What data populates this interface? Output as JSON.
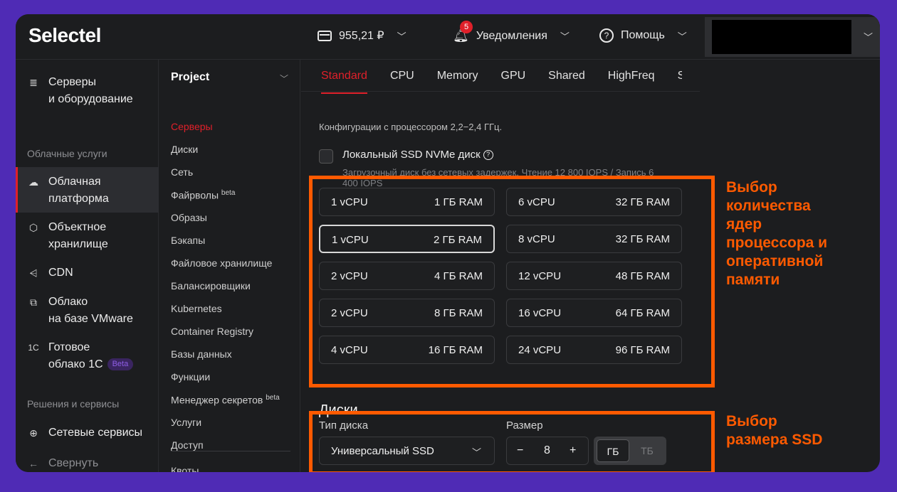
{
  "topbar": {
    "logo": "Selectel",
    "balance": "955,21 ₽",
    "notifications_count": "5",
    "notifications_label": "Уведомления",
    "help_label": "Помощь"
  },
  "sidebar": {
    "items": [
      {
        "icon": "server-icon",
        "line1": "Серверы",
        "line2": "и оборудование"
      },
      {
        "icon": "cloud-icon",
        "line1": "Облачная",
        "line2": "платформа"
      },
      {
        "icon": "cube-icon",
        "line1": "Объектное",
        "line2": "хранилище"
      },
      {
        "icon": "cdn-icon",
        "line1": "CDN"
      },
      {
        "icon": "vmware-icon",
        "line1": "Облако",
        "line2": "на базе VMware"
      },
      {
        "icon": "1c-icon",
        "line1": "Готовое",
        "line2": "облако 1С",
        "badge": "Beta"
      },
      {
        "icon": "globe-icon",
        "line1": "Сетевые сервисы"
      }
    ],
    "icon_glyphs": {
      "server": "≣",
      "cloud": "☁",
      "cube": "⬡",
      "cdn": "⩤",
      "vmware": "⧉",
      "onec": "1С",
      "globe": "⊕"
    },
    "section_cloud": "Облачные услуги",
    "section_solutions": "Решения и сервисы",
    "collapse_label": "Свернуть"
  },
  "project": {
    "title": "Project",
    "menu": [
      "Серверы",
      "Диски",
      "Сеть",
      "Файрволы",
      "Образы",
      "Бэкапы",
      "Файловое хранилище",
      "Балансировщики",
      "Kubernetes",
      "Container Registry",
      "Базы данных",
      "Функции",
      "Менеджер секретов",
      "Услуги",
      "Доступ",
      "Квоты"
    ],
    "beta_sup": "beta"
  },
  "tabs": [
    "Standard",
    "CPU",
    "Memory",
    "GPU",
    "Shared",
    "HighFreq",
    "S"
  ],
  "main": {
    "description": "Конфигурации с процессором 2,2−2,4 ГГц.",
    "local_ssd_label": "Локальный SSD NVMe диск",
    "local_ssd_desc": "Загрузочный диск без сетевых задержек. Чтение 12 800 IOPS / Запись 6 400 IOPS",
    "configs_left": [
      {
        "cpu": "1 vCPU",
        "ram": "1 ГБ RAM"
      },
      {
        "cpu": "1 vCPU",
        "ram": "2 ГБ RAM"
      },
      {
        "cpu": "2 vCPU",
        "ram": "4 ГБ RAM"
      },
      {
        "cpu": "2 vCPU",
        "ram": "8 ГБ RAM"
      },
      {
        "cpu": "4 vCPU",
        "ram": "16 ГБ RAM"
      }
    ],
    "configs_right": [
      {
        "cpu": "6 vCPU",
        "ram": "32 ГБ RAM"
      },
      {
        "cpu": "8 vCPU",
        "ram": "32 ГБ RAM"
      },
      {
        "cpu": "12 vCPU",
        "ram": "48 ГБ RAM"
      },
      {
        "cpu": "16 vCPU",
        "ram": "64 ГБ RAM"
      },
      {
        "cpu": "24 vCPU",
        "ram": "96 ГБ RAM"
      }
    ],
    "disks_title": "Диски",
    "disk_type_label": "Тип диска",
    "disk_type_value": "Универсальный SSD",
    "size_label": "Размер",
    "size_value": "8",
    "unit_gb": "ГБ",
    "unit_tb": "ТБ"
  },
  "annotations": {
    "cpu_ram": [
      "Выбор",
      "количества",
      "ядер",
      "процессора и",
      "оперативной",
      "памяти"
    ],
    "ssd": [
      "Выбор",
      "размера SSD"
    ]
  },
  "colors": {
    "accent_red": "#e0202a",
    "highlight_orange": "#ff5a00",
    "background_purple": "#4f2bb5"
  }
}
